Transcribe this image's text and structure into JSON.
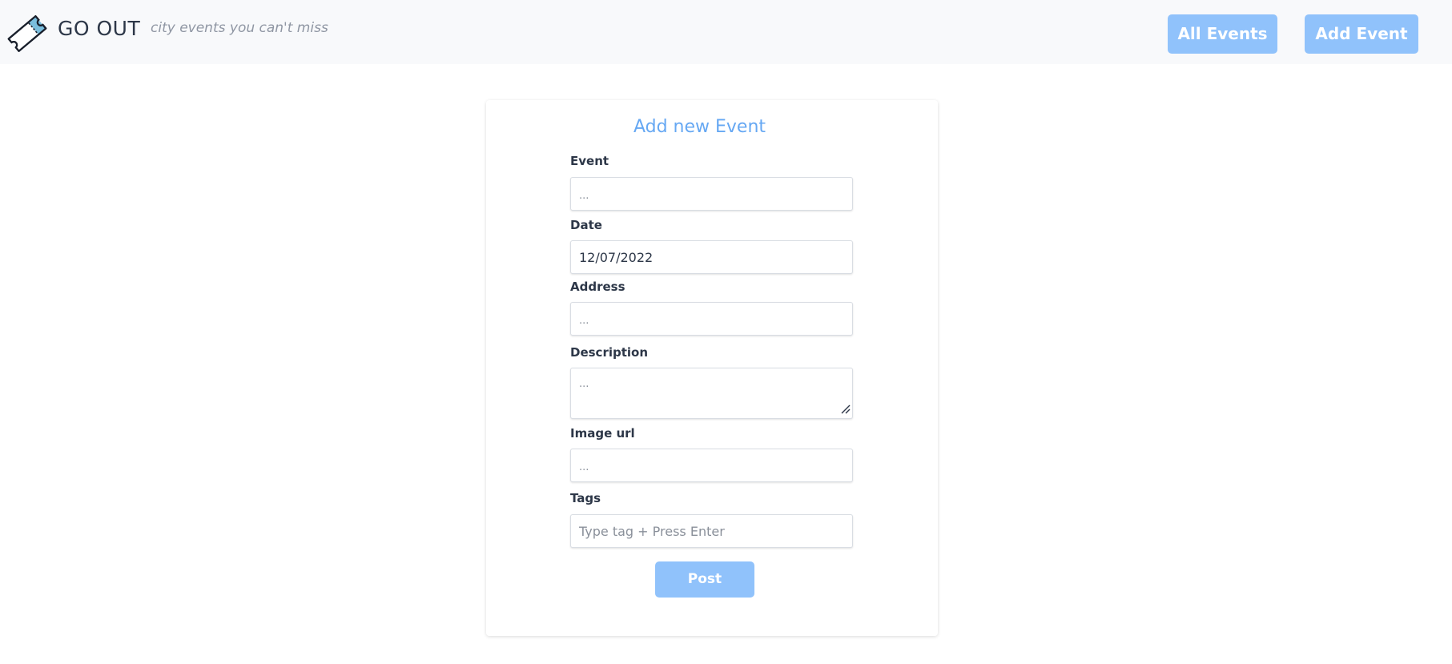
{
  "header": {
    "logo_icon": "ticket-icon",
    "brand": "GO OUT",
    "tagline": "city events you can't miss",
    "nav": {
      "all_events": "All Events",
      "add_event": "Add Event"
    }
  },
  "form": {
    "title": "Add new Event",
    "fields": {
      "event": {
        "label": "Event",
        "value": "",
        "placeholder": "..."
      },
      "date": {
        "label": "Date",
        "value": "12/07/2022"
      },
      "address": {
        "label": "Address",
        "value": "",
        "placeholder": "..."
      },
      "description": {
        "label": "Description",
        "value": "",
        "placeholder": "..."
      },
      "image_url": {
        "label": "Image url",
        "value": "",
        "placeholder": "..."
      },
      "tags": {
        "label": "Tags",
        "value": "",
        "placeholder": "Type tag + Press Enter"
      }
    },
    "submit_label": "Post"
  },
  "colors": {
    "accent": "#90c2fb",
    "title": "#66a8f3",
    "header_bg": "#f8f9fb",
    "text": "#2d3748"
  }
}
